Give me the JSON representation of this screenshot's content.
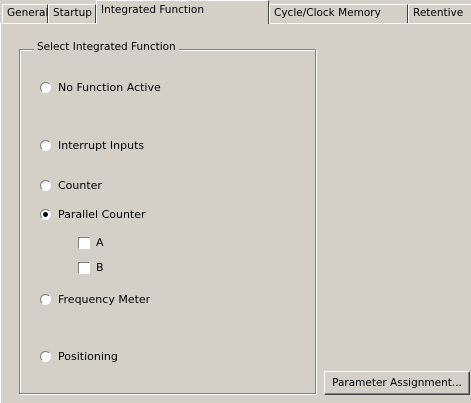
{
  "tabs": [
    "General",
    "Startup",
    "Integrated Function",
    "Cycle/Clock Memory",
    "Retentive"
  ],
  "group": {
    "title": "Select Integrated Function",
    "options": [
      "No Function Active",
      "Interrupt Inputs",
      "Counter",
      "Parallel Counter",
      "Frequency Meter",
      "Positioning"
    ],
    "selected": "Parallel Counter",
    "counter_channels": [
      "A",
      "B"
    ]
  },
  "parameter_button": "Parameter Assignment..."
}
